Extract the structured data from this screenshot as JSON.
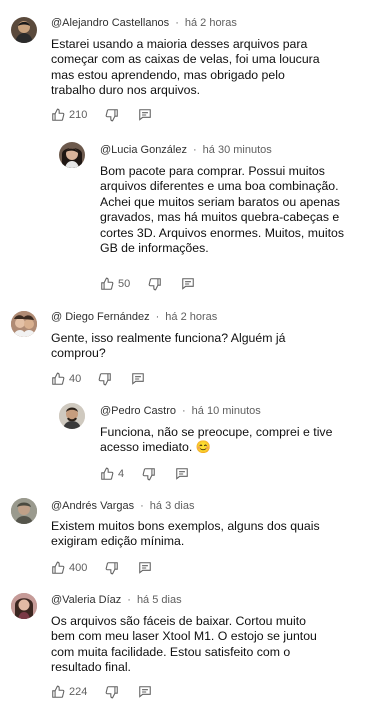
{
  "comments": [
    {
      "author": "@Alejandro Castellanos",
      "time": "há 2 horas",
      "text": "Estarei usando a maioria desses arquivos para começar com as caixas de velas, foi uma loucura mas estou aprendendo, mas obrigado pelo trabalho duro nos arquivos.",
      "likes": "210",
      "is_reply": false
    },
    {
      "author": "@Lucia González",
      "time": "há 30 minutos",
      "text": "Bom pacote para comprar. Possui muitos arquivos diferentes e uma boa combinação. Achei que muitos seriam baratos ou apenas gravados, mas há muitos quebra-cabeças e cortes 3D. Arquivos enormes. Muitos, muitos GB de informações.",
      "likes": "50",
      "is_reply": true
    },
    {
      "author": "@ Diego Fernández",
      "time": "há 2 horas",
      "text": "Gente, isso realmente funciona? Alguém já comprou?",
      "likes": "40",
      "is_reply": false
    },
    {
      "author": "@Pedro Castro",
      "time": "há 10 minutos",
      "text": "Funciona, não se preocupe, comprei e tive acesso imediato. 😊",
      "likes": "4",
      "is_reply": true
    },
    {
      "author": "@Andrés Vargas",
      "time": "há 3 dias",
      "text": "Existem muitos bons exemplos, alguns dos quais exigiram edição mínima.",
      "likes": "400",
      "is_reply": false
    },
    {
      "author": "@Valeria Díaz",
      "time": "há 5 dias",
      "text": "Os arquivos são fáceis de baixar. Cortou muito bem com meu laser Xtool M1. O estojo se juntou com muita facilidade. Estou satisfeito com o resultado final.",
      "likes": "224",
      "is_reply": false
    }
  ],
  "icons": {
    "like": "thumb-up-icon",
    "dislike": "thumb-down-icon",
    "reply": "reply-comment-icon"
  },
  "colors": {
    "text": "#0f0f0f",
    "meta": "#606060",
    "icon": "#606060"
  }
}
